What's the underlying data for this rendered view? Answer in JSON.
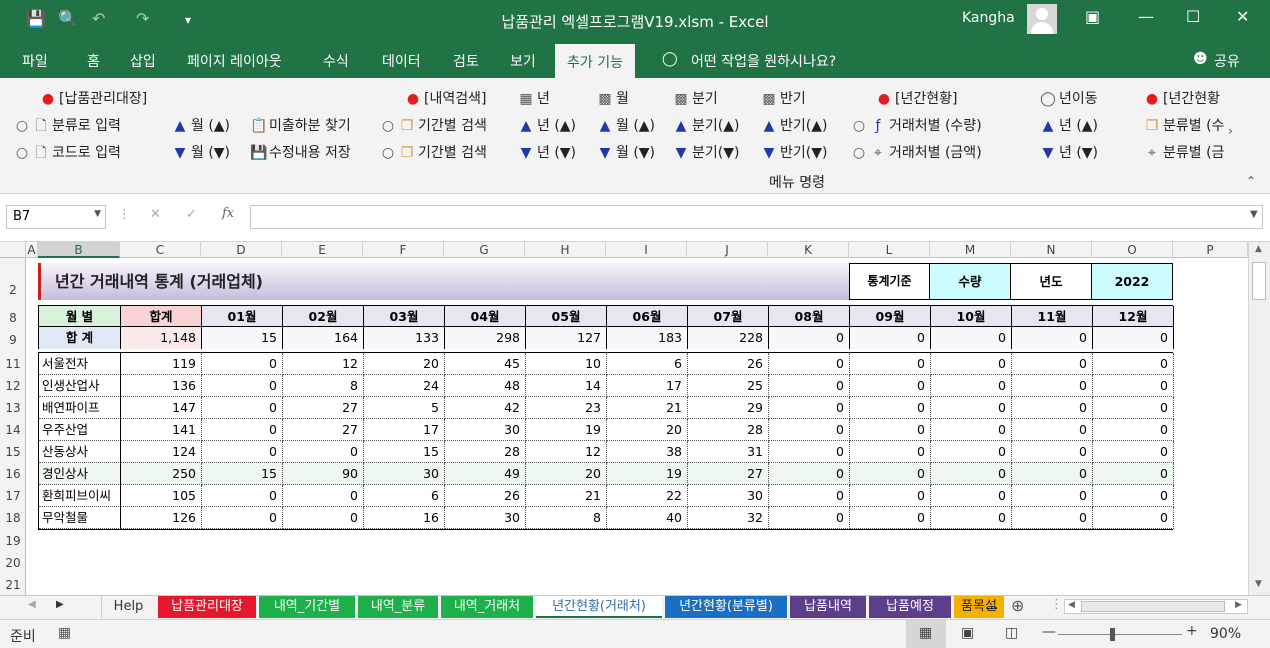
{
  "window": {
    "title": "납품관리 엑셀프로그램V19.xlsm  -  Excel",
    "user": "Kangha"
  },
  "ribbon_tabs": [
    "파일",
    "홈",
    "삽입",
    "페이지 레이아웃",
    "수식",
    "데이터",
    "검토",
    "보기",
    "추가 기능"
  ],
  "tell_me": "어떤 작업을 원하시나요?",
  "share": "공유",
  "ribbon": {
    "group_label": "메뉴 명령",
    "items": {
      "napum": "[납품관리대장]",
      "cat_input": "분류로 입력",
      "code_input": "코드로 입력",
      "month_up": "월 (▲)",
      "month_dn": "월 (▼)",
      "unpaid": "미출하분 찾기",
      "save_edit": "수정내용 저장",
      "search": "[내역검색]",
      "period1": "기간별 검색",
      "period2": "기간별 검색",
      "year": "년",
      "year_up": "년 (▲)",
      "year_dn": "년 (▼)",
      "month": "월",
      "month2_up": "월 (▲)",
      "month2_dn": "월 (▼)",
      "quarter": "분기",
      "quarter_up": "분기(▲)",
      "quarter_dn": "분기(▼)",
      "half": "반기",
      "half_up": "반기(▲)",
      "half_dn": "반기(▼)",
      "annual": "[년간현황]",
      "by_client_qty": "거래처별 (수량)",
      "by_client_amt": "거래처별 (금액)",
      "year_move": "년이동",
      "ym_up": "년 (▲)",
      "ym_dn": "년 (▼)",
      "annual2": "[년간현황",
      "by_cat1": "분류별 (수",
      "by_cat2": "분류별 (금"
    }
  },
  "formula_bar": {
    "name_box": "B7",
    "formula": ""
  },
  "columns": [
    "A",
    "B",
    "C",
    "D",
    "E",
    "F",
    "G",
    "H",
    "I",
    "J",
    "K",
    "L",
    "M",
    "N",
    "O",
    "P"
  ],
  "rows": [
    "2",
    "8",
    "9",
    "11",
    "12",
    "13",
    "14",
    "15",
    "16",
    "17",
    "18",
    "19",
    "20",
    "21"
  ],
  "sheet": {
    "title": "년간 거래내역 통계 (거래업체)",
    "basis_label": "통계기준",
    "basis_value": "수량",
    "year_label": "년도",
    "year_value": "2022",
    "month_header": "월   별",
    "total_header": "합계",
    "sum_label": "합   계",
    "months": [
      "01월",
      "02월",
      "03월",
      "04월",
      "05월",
      "06월",
      "07월",
      "08월",
      "09월",
      "10월",
      "11월",
      "12월"
    ],
    "totals": [
      "1,148",
      "15",
      "164",
      "133",
      "298",
      "127",
      "183",
      "228",
      "0",
      "0",
      "0",
      "0",
      "0"
    ],
    "companies": [
      {
        "name": "서울전자",
        "values": [
          "119",
          "0",
          "12",
          "20",
          "45",
          "10",
          "6",
          "26",
          "0",
          "0",
          "0",
          "0",
          "0"
        ]
      },
      {
        "name": "인생산업사",
        "values": [
          "136",
          "0",
          "8",
          "24",
          "48",
          "14",
          "17",
          "25",
          "0",
          "0",
          "0",
          "0",
          "0"
        ]
      },
      {
        "name": "배연파이프",
        "values": [
          "147",
          "0",
          "27",
          "5",
          "42",
          "23",
          "21",
          "29",
          "0",
          "0",
          "0",
          "0",
          "0"
        ]
      },
      {
        "name": "우주산업",
        "values": [
          "141",
          "0",
          "27",
          "17",
          "30",
          "19",
          "20",
          "28",
          "0",
          "0",
          "0",
          "0",
          "0"
        ]
      },
      {
        "name": "산동상사",
        "values": [
          "124",
          "0",
          "0",
          "15",
          "28",
          "12",
          "38",
          "31",
          "0",
          "0",
          "0",
          "0",
          "0"
        ]
      },
      {
        "name": "경인상사",
        "values": [
          "250",
          "15",
          "90",
          "30",
          "49",
          "20",
          "19",
          "27",
          "0",
          "0",
          "0",
          "0",
          "0"
        ]
      },
      {
        "name": "환희피브이씨",
        "values": [
          "105",
          "0",
          "0",
          "6",
          "26",
          "21",
          "22",
          "30",
          "0",
          "0",
          "0",
          "0",
          "0"
        ]
      },
      {
        "name": "무악철물",
        "values": [
          "126",
          "0",
          "0",
          "16",
          "30",
          "8",
          "40",
          "32",
          "0",
          "0",
          "0",
          "0",
          "0"
        ]
      }
    ]
  },
  "sheet_tabs": [
    {
      "label": "Help",
      "color": "#f3f3f3",
      "text": "#333"
    },
    {
      "label": "납품관리대장",
      "color": "#e8182c",
      "text": "#ffffff"
    },
    {
      "label": "내역_기간별",
      "color": "#1db04b",
      "text": "#ffffff"
    },
    {
      "label": "내역_분류",
      "color": "#1db04b",
      "text": "#ffffff"
    },
    {
      "label": "내역_거래처",
      "color": "#1db04b",
      "text": "#ffffff"
    },
    {
      "label": "년간현황(거래처)",
      "color": "#ffffff",
      "text": "#2e6ea8"
    },
    {
      "label": "년간현황(분류별)",
      "color": "#1a6fc4",
      "text": "#ffffff"
    },
    {
      "label": "납품내역",
      "color": "#5b3f8a",
      "text": "#ffffff"
    },
    {
      "label": "납품예정",
      "color": "#5b3f8a",
      "text": "#ffffff"
    },
    {
      "label": "품목설",
      "color": "#f5b000",
      "text": "#222222"
    }
  ],
  "more_tabs": "...",
  "status": {
    "mode": "준비",
    "zoom": "90%"
  },
  "colors": {
    "accent": "#217346",
    "title_grad_start": "#f4f0f8",
    "title_grad_end": "#c9bedb",
    "cyan_cell": "#ccfcff",
    "header_pink": "#f7d3d3",
    "header_green": "#d9f0d9"
  }
}
